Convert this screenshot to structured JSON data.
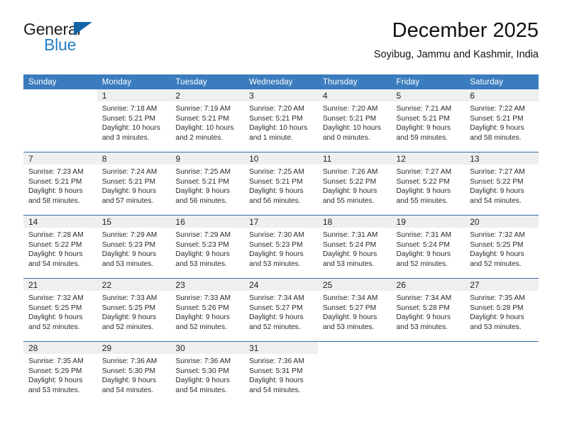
{
  "logo": {
    "word1": "General",
    "word2": "Blue",
    "triangle_color": "#1565a8",
    "blue_text_color": "#1f7dc4"
  },
  "header": {
    "title": "December 2025",
    "subtitle": "Soyibug, Jammu and Kashmir, India"
  },
  "theme": {
    "header_bg": "#3a7cbe",
    "row_separator": "#2f6da8",
    "daynum_band_bg": "#efefef",
    "text": "#2a2a2a"
  },
  "weekday_headers": [
    "Sunday",
    "Monday",
    "Tuesday",
    "Wednesday",
    "Thursday",
    "Friday",
    "Saturday"
  ],
  "weeks": [
    [
      {
        "day": "",
        "sunrise": "",
        "sunset": "",
        "daylight_line1": "",
        "daylight_line2": ""
      },
      {
        "day": "1",
        "sunrise": "Sunrise: 7:18 AM",
        "sunset": "Sunset: 5:21 PM",
        "daylight_line1": "Daylight: 10 hours",
        "daylight_line2": "and 3 minutes."
      },
      {
        "day": "2",
        "sunrise": "Sunrise: 7:19 AM",
        "sunset": "Sunset: 5:21 PM",
        "daylight_line1": "Daylight: 10 hours",
        "daylight_line2": "and 2 minutes."
      },
      {
        "day": "3",
        "sunrise": "Sunrise: 7:20 AM",
        "sunset": "Sunset: 5:21 PM",
        "daylight_line1": "Daylight: 10 hours",
        "daylight_line2": "and 1 minute."
      },
      {
        "day": "4",
        "sunrise": "Sunrise: 7:20 AM",
        "sunset": "Sunset: 5:21 PM",
        "daylight_line1": "Daylight: 10 hours",
        "daylight_line2": "and 0 minutes."
      },
      {
        "day": "5",
        "sunrise": "Sunrise: 7:21 AM",
        "sunset": "Sunset: 5:21 PM",
        "daylight_line1": "Daylight: 9 hours",
        "daylight_line2": "and 59 minutes."
      },
      {
        "day": "6",
        "sunrise": "Sunrise: 7:22 AM",
        "sunset": "Sunset: 5:21 PM",
        "daylight_line1": "Daylight: 9 hours",
        "daylight_line2": "and 58 minutes."
      }
    ],
    [
      {
        "day": "7",
        "sunrise": "Sunrise: 7:23 AM",
        "sunset": "Sunset: 5:21 PM",
        "daylight_line1": "Daylight: 9 hours",
        "daylight_line2": "and 58 minutes."
      },
      {
        "day": "8",
        "sunrise": "Sunrise: 7:24 AM",
        "sunset": "Sunset: 5:21 PM",
        "daylight_line1": "Daylight: 9 hours",
        "daylight_line2": "and 57 minutes."
      },
      {
        "day": "9",
        "sunrise": "Sunrise: 7:25 AM",
        "sunset": "Sunset: 5:21 PM",
        "daylight_line1": "Daylight: 9 hours",
        "daylight_line2": "and 56 minutes."
      },
      {
        "day": "10",
        "sunrise": "Sunrise: 7:25 AM",
        "sunset": "Sunset: 5:21 PM",
        "daylight_line1": "Daylight: 9 hours",
        "daylight_line2": "and 56 minutes."
      },
      {
        "day": "11",
        "sunrise": "Sunrise: 7:26 AM",
        "sunset": "Sunset: 5:22 PM",
        "daylight_line1": "Daylight: 9 hours",
        "daylight_line2": "and 55 minutes."
      },
      {
        "day": "12",
        "sunrise": "Sunrise: 7:27 AM",
        "sunset": "Sunset: 5:22 PM",
        "daylight_line1": "Daylight: 9 hours",
        "daylight_line2": "and 55 minutes."
      },
      {
        "day": "13",
        "sunrise": "Sunrise: 7:27 AM",
        "sunset": "Sunset: 5:22 PM",
        "daylight_line1": "Daylight: 9 hours",
        "daylight_line2": "and 54 minutes."
      }
    ],
    [
      {
        "day": "14",
        "sunrise": "Sunrise: 7:28 AM",
        "sunset": "Sunset: 5:22 PM",
        "daylight_line1": "Daylight: 9 hours",
        "daylight_line2": "and 54 minutes."
      },
      {
        "day": "15",
        "sunrise": "Sunrise: 7:29 AM",
        "sunset": "Sunset: 5:23 PM",
        "daylight_line1": "Daylight: 9 hours",
        "daylight_line2": "and 53 minutes."
      },
      {
        "day": "16",
        "sunrise": "Sunrise: 7:29 AM",
        "sunset": "Sunset: 5:23 PM",
        "daylight_line1": "Daylight: 9 hours",
        "daylight_line2": "and 53 minutes."
      },
      {
        "day": "17",
        "sunrise": "Sunrise: 7:30 AM",
        "sunset": "Sunset: 5:23 PM",
        "daylight_line1": "Daylight: 9 hours",
        "daylight_line2": "and 53 minutes."
      },
      {
        "day": "18",
        "sunrise": "Sunrise: 7:31 AM",
        "sunset": "Sunset: 5:24 PM",
        "daylight_line1": "Daylight: 9 hours",
        "daylight_line2": "and 53 minutes."
      },
      {
        "day": "19",
        "sunrise": "Sunrise: 7:31 AM",
        "sunset": "Sunset: 5:24 PM",
        "daylight_line1": "Daylight: 9 hours",
        "daylight_line2": "and 52 minutes."
      },
      {
        "day": "20",
        "sunrise": "Sunrise: 7:32 AM",
        "sunset": "Sunset: 5:25 PM",
        "daylight_line1": "Daylight: 9 hours",
        "daylight_line2": "and 52 minutes."
      }
    ],
    [
      {
        "day": "21",
        "sunrise": "Sunrise: 7:32 AM",
        "sunset": "Sunset: 5:25 PM",
        "daylight_line1": "Daylight: 9 hours",
        "daylight_line2": "and 52 minutes."
      },
      {
        "day": "22",
        "sunrise": "Sunrise: 7:33 AM",
        "sunset": "Sunset: 5:25 PM",
        "daylight_line1": "Daylight: 9 hours",
        "daylight_line2": "and 52 minutes."
      },
      {
        "day": "23",
        "sunrise": "Sunrise: 7:33 AM",
        "sunset": "Sunset: 5:26 PM",
        "daylight_line1": "Daylight: 9 hours",
        "daylight_line2": "and 52 minutes."
      },
      {
        "day": "24",
        "sunrise": "Sunrise: 7:34 AM",
        "sunset": "Sunset: 5:27 PM",
        "daylight_line1": "Daylight: 9 hours",
        "daylight_line2": "and 52 minutes."
      },
      {
        "day": "25",
        "sunrise": "Sunrise: 7:34 AM",
        "sunset": "Sunset: 5:27 PM",
        "daylight_line1": "Daylight: 9 hours",
        "daylight_line2": "and 53 minutes."
      },
      {
        "day": "26",
        "sunrise": "Sunrise: 7:34 AM",
        "sunset": "Sunset: 5:28 PM",
        "daylight_line1": "Daylight: 9 hours",
        "daylight_line2": "and 53 minutes."
      },
      {
        "day": "27",
        "sunrise": "Sunrise: 7:35 AM",
        "sunset": "Sunset: 5:28 PM",
        "daylight_line1": "Daylight: 9 hours",
        "daylight_line2": "and 53 minutes."
      }
    ],
    [
      {
        "day": "28",
        "sunrise": "Sunrise: 7:35 AM",
        "sunset": "Sunset: 5:29 PM",
        "daylight_line1": "Daylight: 9 hours",
        "daylight_line2": "and 53 minutes."
      },
      {
        "day": "29",
        "sunrise": "Sunrise: 7:36 AM",
        "sunset": "Sunset: 5:30 PM",
        "daylight_line1": "Daylight: 9 hours",
        "daylight_line2": "and 54 minutes."
      },
      {
        "day": "30",
        "sunrise": "Sunrise: 7:36 AM",
        "sunset": "Sunset: 5:30 PM",
        "daylight_line1": "Daylight: 9 hours",
        "daylight_line2": "and 54 minutes."
      },
      {
        "day": "31",
        "sunrise": "Sunrise: 7:36 AM",
        "sunset": "Sunset: 5:31 PM",
        "daylight_line1": "Daylight: 9 hours",
        "daylight_line2": "and 54 minutes."
      },
      {
        "day": "",
        "sunrise": "",
        "sunset": "",
        "daylight_line1": "",
        "daylight_line2": ""
      },
      {
        "day": "",
        "sunrise": "",
        "sunset": "",
        "daylight_line1": "",
        "daylight_line2": ""
      },
      {
        "day": "",
        "sunrise": "",
        "sunset": "",
        "daylight_line1": "",
        "daylight_line2": ""
      }
    ]
  ]
}
